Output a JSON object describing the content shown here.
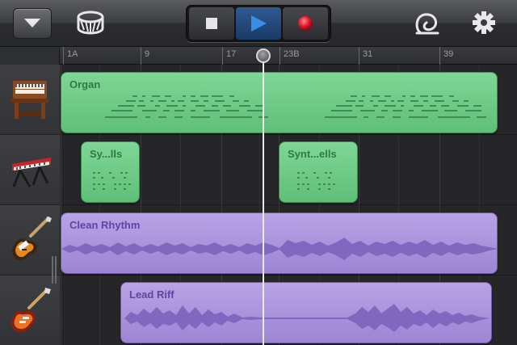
{
  "toolbar": {
    "menu_icon": "chevron-down-icon",
    "browser_icon": "drum-icon",
    "transport": {
      "stop_icon": "stop-icon",
      "play_icon": "play-icon",
      "record_icon": "record-icon",
      "active": "play"
    },
    "loop_icon": "loop-icon",
    "settings_icon": "gear-icon"
  },
  "ruler": {
    "marks": [
      "1A",
      "9",
      "17",
      "23B",
      "31",
      "39"
    ]
  },
  "instruments": [
    {
      "name": "organ",
      "icon": "organ-icon"
    },
    {
      "name": "synth",
      "icon": "keyboard-icon"
    },
    {
      "name": "clean-guitar",
      "icon": "electric-guitar-icon"
    },
    {
      "name": "lead-guitar",
      "icon": "electric-guitar-icon"
    }
  ],
  "regions": [
    {
      "label": "Organ",
      "type": "midi"
    },
    {
      "label": "Sy...lls",
      "type": "midi"
    },
    {
      "label": "Synt...ells",
      "type": "midi"
    },
    {
      "label": "Clean Rhythm",
      "type": "audio"
    },
    {
      "label": "Lead Riff",
      "type": "audio"
    }
  ],
  "colors": {
    "midi_region": "#6fcb88",
    "audio_region": "#ab94dd",
    "play_active": "#3a8ee6",
    "record": "#e0192a"
  }
}
